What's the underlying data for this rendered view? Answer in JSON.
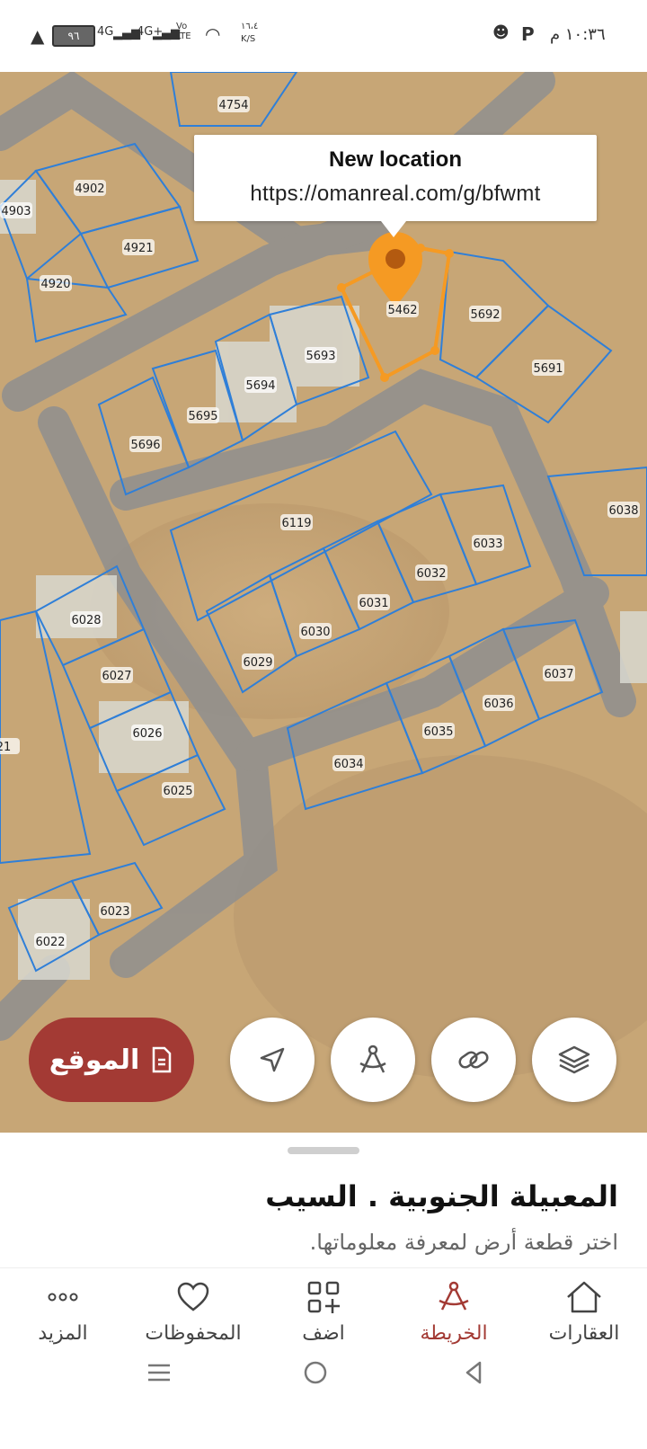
{
  "status_bar": {
    "time": "١٠:٣٦ م",
    "battery": "٩٦",
    "network_1": "4G",
    "network_2": "4G+",
    "volte": "Vo LTE",
    "speed": "١٦،٤",
    "speed_unit": "K/S",
    "p_letter": "P"
  },
  "tooltip": {
    "title": "New location",
    "url": "https://omanreal.com/g/bfwmt"
  },
  "parcels": [
    "4754",
    "4902",
    "4903",
    "4921",
    "4920",
    "5692",
    "5462",
    "5691",
    "5693",
    "5694",
    "5695",
    "5696",
    "6119",
    "6038",
    "6033",
    "6032",
    "6031",
    "6028",
    "6030",
    "6029",
    "6027",
    "6037",
    "6036",
    "6035",
    "6034",
    "6026",
    "6025",
    "6023",
    "6022",
    "21"
  ],
  "location_button": {
    "label": "الموقع",
    "icon": "document-icon"
  },
  "map_actions": [
    {
      "icon": "navigation-arrow-icon"
    },
    {
      "icon": "measure-compass-icon"
    },
    {
      "icon": "link-icon"
    },
    {
      "icon": "layers-icon"
    }
  ],
  "sheet": {
    "title": "المعبيلة الجنوبية . السيب",
    "subtitle": "اختر قطعة أرض لمعرفة معلوماتها."
  },
  "nav": {
    "items": [
      {
        "label": "المزيد",
        "icon": "more-dots-icon"
      },
      {
        "label": "المحفوظات",
        "icon": "heart-icon"
      },
      {
        "label": "اضف",
        "icon": "add-grid-icon"
      },
      {
        "label": "الخريطة",
        "icon": "map-compass-icon",
        "active": true
      },
      {
        "label": "العقارات",
        "icon": "home-icon"
      }
    ]
  },
  "colors": {
    "accent": "#a33a34",
    "marker": "#f59a23",
    "parcel_line": "#2f7fd8",
    "road": "#8f8f8f"
  }
}
